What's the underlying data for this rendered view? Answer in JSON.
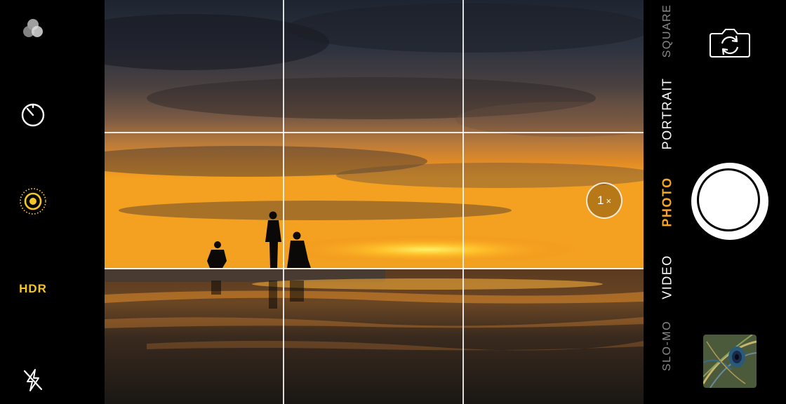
{
  "left_controls": {
    "filters_icon": "filters-icon",
    "timer_icon": "timer-icon",
    "live_photo_icon": "live-photo-icon",
    "hdr_label": "HDR",
    "flash_icon": "flash-off-icon"
  },
  "viewfinder": {
    "zoom_value": "1",
    "zoom_suffix": "×",
    "grid": true
  },
  "modes": [
    {
      "label": "SQUARE",
      "state": "dim"
    },
    {
      "label": "PORTRAIT",
      "state": "normal"
    },
    {
      "label": "PHOTO",
      "state": "active"
    },
    {
      "label": "VIDEO",
      "state": "normal"
    },
    {
      "label": "SLO-MO",
      "state": "dim"
    }
  ],
  "right_controls": {
    "flip_camera_icon": "flip-camera-icon",
    "shutter_icon": "shutter-button",
    "thumbnail_icon": "last-photo-thumbnail"
  },
  "colors": {
    "accent": "#f5c528",
    "active_mode": "#f5a623"
  }
}
